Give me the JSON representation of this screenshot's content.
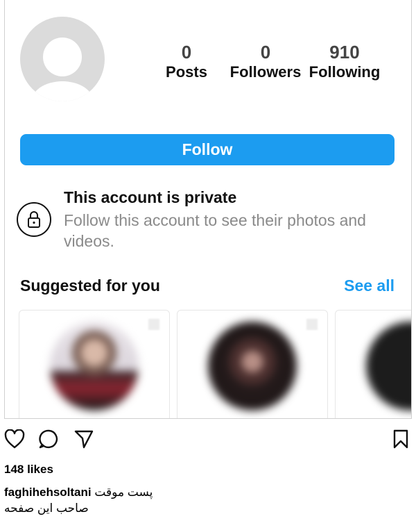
{
  "profile": {
    "stats": [
      {
        "value": "0",
        "label": "Posts"
      },
      {
        "value": "0",
        "label": "Followers"
      },
      {
        "value": "910",
        "label": "Following"
      }
    ],
    "follow_label": "Follow",
    "private_title": "This account is private",
    "private_desc": "Follow this account to see their photos and videos.",
    "suggested_title": "Suggested for you",
    "see_all": "See all"
  },
  "post": {
    "likes": "148 likes",
    "username": "faghihehsoltani",
    "caption": "پست موقت",
    "line2": "صاحب این صفحه"
  },
  "icons": [
    "heart-icon",
    "comment-icon",
    "share-icon",
    "bookmark-icon",
    "lock-icon",
    "avatar-placeholder"
  ],
  "colors": {
    "accent": "#1c9cf0",
    "muted": "#8a8a8a"
  }
}
